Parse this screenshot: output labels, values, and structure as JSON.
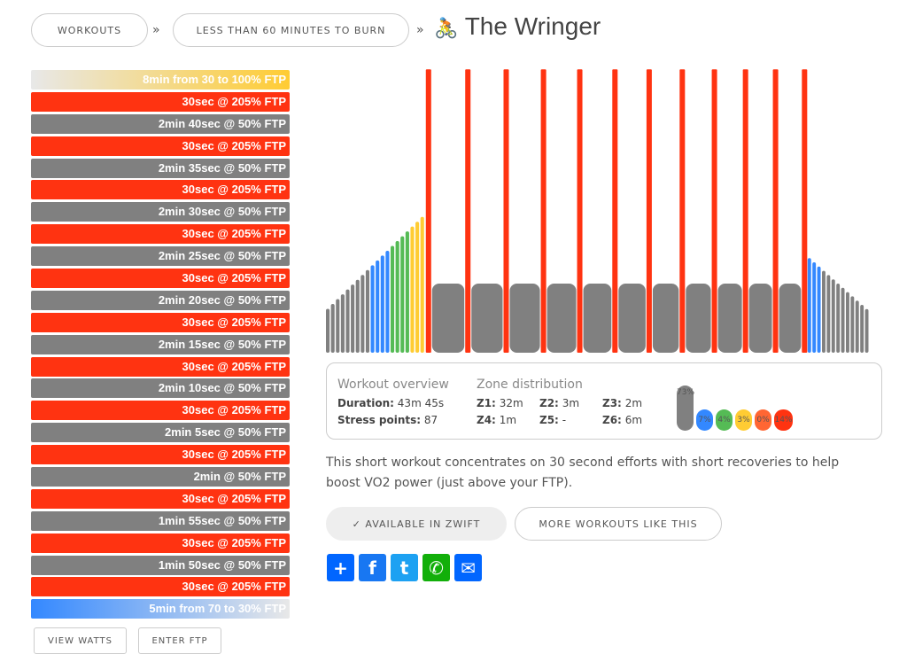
{
  "breadcrumb": {
    "items": [
      "WORKOUTS",
      "LESS THAN 60 MINUTES TO BURN"
    ],
    "separator": "»"
  },
  "title": "The Wringer",
  "title_icon": "cyclist-icon",
  "colors": {
    "z1": "#808080",
    "z2": "#3388ff",
    "z3": "#55bb55",
    "z4": "#ffcc33",
    "z5": "#ff6633",
    "z6": "#ff3311"
  },
  "segments": [
    {
      "label": "8min from 30 to 100% FTP",
      "type": "ramp",
      "dur": 480,
      "from": 30,
      "to": 100
    },
    {
      "label": "30sec @ 205% FTP",
      "type": "steady",
      "dur": 30,
      "pct": 205
    },
    {
      "label": "2min 40sec @ 50% FTP",
      "type": "steady",
      "dur": 160,
      "pct": 50
    },
    {
      "label": "30sec @ 205% FTP",
      "type": "steady",
      "dur": 30,
      "pct": 205
    },
    {
      "label": "2min 35sec @ 50% FTP",
      "type": "steady",
      "dur": 155,
      "pct": 50
    },
    {
      "label": "30sec @ 205% FTP",
      "type": "steady",
      "dur": 30,
      "pct": 205
    },
    {
      "label": "2min 30sec @ 50% FTP",
      "type": "steady",
      "dur": 150,
      "pct": 50
    },
    {
      "label": "30sec @ 205% FTP",
      "type": "steady",
      "dur": 30,
      "pct": 205
    },
    {
      "label": "2min 25sec @ 50% FTP",
      "type": "steady",
      "dur": 145,
      "pct": 50
    },
    {
      "label": "30sec @ 205% FTP",
      "type": "steady",
      "dur": 30,
      "pct": 205
    },
    {
      "label": "2min 20sec @ 50% FTP",
      "type": "steady",
      "dur": 140,
      "pct": 50
    },
    {
      "label": "30sec @ 205% FTP",
      "type": "steady",
      "dur": 30,
      "pct": 205
    },
    {
      "label": "2min 15sec @ 50% FTP",
      "type": "steady",
      "dur": 135,
      "pct": 50
    },
    {
      "label": "30sec @ 205% FTP",
      "type": "steady",
      "dur": 30,
      "pct": 205
    },
    {
      "label": "2min 10sec @ 50% FTP",
      "type": "steady",
      "dur": 130,
      "pct": 50
    },
    {
      "label": "30sec @ 205% FTP",
      "type": "steady",
      "dur": 30,
      "pct": 205
    },
    {
      "label": "2min 5sec @ 50% FTP",
      "type": "steady",
      "dur": 125,
      "pct": 50
    },
    {
      "label": "30sec @ 205% FTP",
      "type": "steady",
      "dur": 30,
      "pct": 205
    },
    {
      "label": "2min @ 50% FTP",
      "type": "steady",
      "dur": 120,
      "pct": 50
    },
    {
      "label": "30sec @ 205% FTP",
      "type": "steady",
      "dur": 30,
      "pct": 205
    },
    {
      "label": "1min 55sec @ 50% FTP",
      "type": "steady",
      "dur": 115,
      "pct": 50
    },
    {
      "label": "30sec @ 205% FTP",
      "type": "steady",
      "dur": 30,
      "pct": 205
    },
    {
      "label": "1min 50sec @ 50% FTP",
      "type": "steady",
      "dur": 110,
      "pct": 50
    },
    {
      "label": "30sec @ 205% FTP",
      "type": "steady",
      "dur": 30,
      "pct": 205
    },
    {
      "label": "5min from 70 to 30% FTP",
      "type": "ramp",
      "dur": 300,
      "from": 70,
      "to": 30
    }
  ],
  "buttons": {
    "view_watts": "VIEW WATTS",
    "enter_ftp": "ENTER FTP",
    "available": "✓ AVAILABLE IN ZWIFT",
    "more": "MORE WORKOUTS LIKE THIS"
  },
  "overview": {
    "heading": "Workout overview",
    "duration_label": "Duration:",
    "duration": "43m 45s",
    "stress_label": "Stress points:",
    "stress": "87"
  },
  "zones": {
    "heading": "Zone distribution",
    "items": [
      {
        "label": "Z1:",
        "value": "32m"
      },
      {
        "label": "Z2:",
        "value": "3m"
      },
      {
        "label": "Z3:",
        "value": "2m"
      },
      {
        "label": "Z4:",
        "value": "1m"
      },
      {
        "label": "Z5:",
        "value": "-"
      },
      {
        "label": "Z6:",
        "value": "6m"
      }
    ],
    "percents": [
      "73%",
      "7%",
      "4%",
      "3%",
      "0%",
      "14%"
    ]
  },
  "description": "This short workout concentrates on 30 second efforts with short recoveries to help boost VO2 power (just above your FTP).",
  "share": [
    {
      "icon": "plus-icon",
      "color": "#0166ff"
    },
    {
      "icon": "facebook-icon",
      "color": "#1877f2"
    },
    {
      "icon": "twitter-icon",
      "color": "#1da1f2"
    },
    {
      "icon": "whatsapp-icon",
      "color": "#12af0a"
    },
    {
      "icon": "email-icon",
      "color": "#0166ff"
    }
  ]
}
